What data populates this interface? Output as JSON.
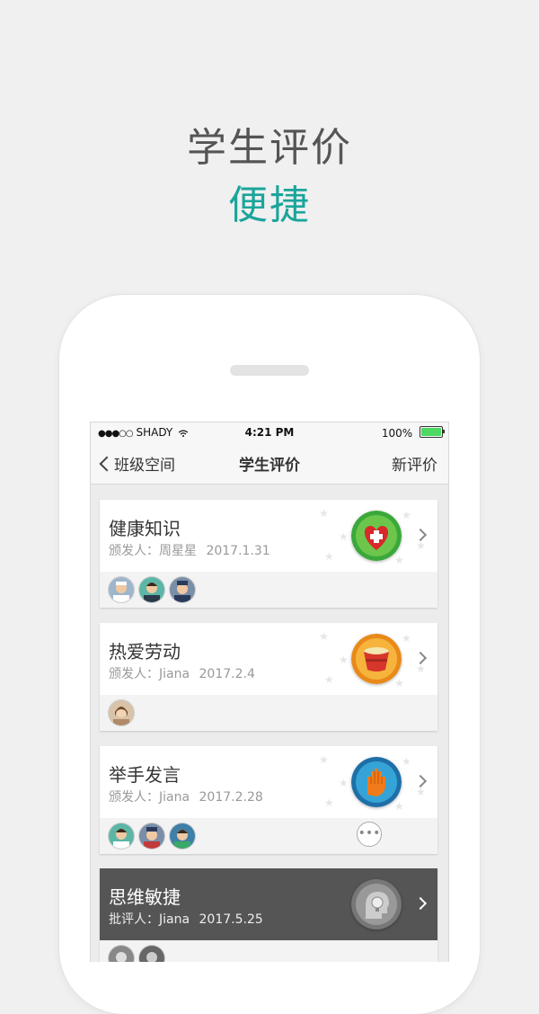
{
  "hero": {
    "title": "学生评价",
    "subtitle": "便捷"
  },
  "status_bar": {
    "carrier_dots": "●●●○○",
    "carrier": "SHADY",
    "time": "4:21 PM",
    "battery": "100%"
  },
  "nav": {
    "back_label": "班级空间",
    "title": "学生评价",
    "action_label": "新评价"
  },
  "cards": [
    {
      "name": "健康知识",
      "issuer_label": "颁发人：",
      "issuer": "周星星",
      "date": "2017.1.31",
      "badge_icon": "heart-cross-icon"
    },
    {
      "name": "热爱劳动",
      "issuer_label": "颁发人：",
      "issuer": "Jiana",
      "date": "2017.2.4",
      "badge_icon": "bucket-icon"
    },
    {
      "name": "举手发言",
      "issuer_label": "颁发人：",
      "issuer": "Jiana",
      "date": "2017.2.28",
      "badge_icon": "raised-hand-icon"
    },
    {
      "name": "思维敏捷",
      "issuer_label": "批评人：",
      "issuer": "Jiana",
      "date": "2017.5.25",
      "badge_icon": "brain-bulb-icon"
    }
  ],
  "more_label": "•••",
  "colors": {
    "accent": "#1aa59b",
    "card_dark": "#555555"
  }
}
